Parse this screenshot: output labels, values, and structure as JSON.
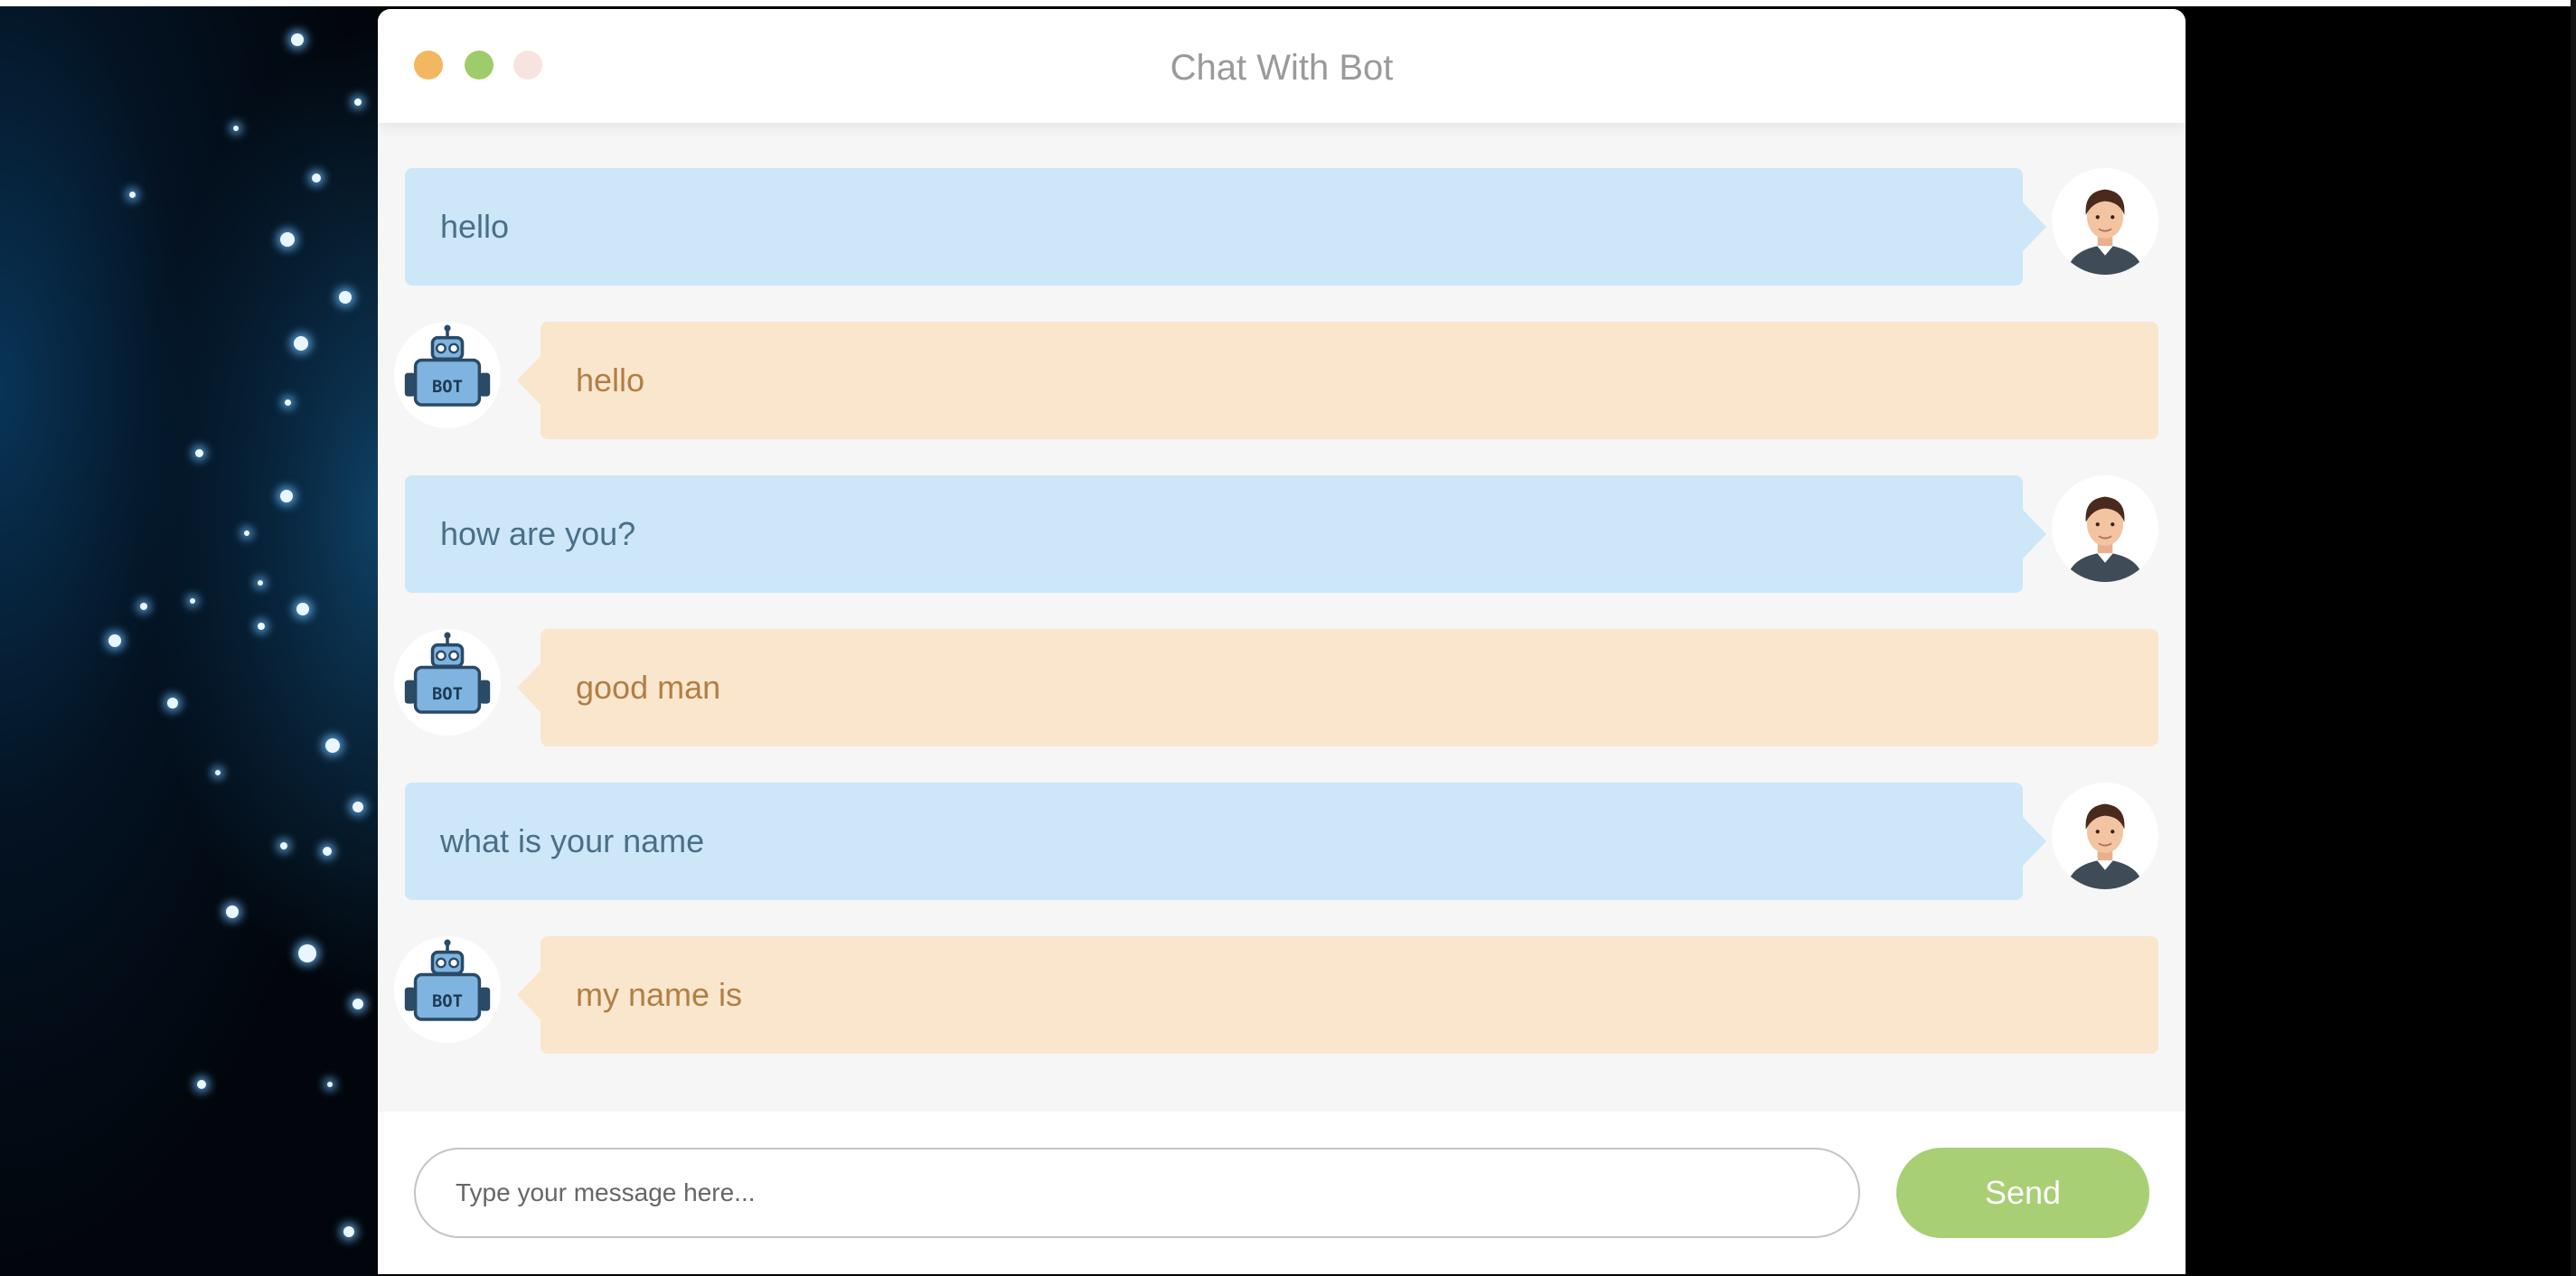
{
  "window": {
    "title": "Chat With Bot",
    "traffic_lights": [
      {
        "name": "close",
        "color": "#f3b661"
      },
      {
        "name": "minimize",
        "color": "#9fcc6a"
      },
      {
        "name": "zoom",
        "color": "#f7e4e0"
      }
    ]
  },
  "messages": [
    {
      "sender": "user",
      "avatar": "user-avatar-icon",
      "text": "hello"
    },
    {
      "sender": "bot",
      "avatar": "robot-bot-icon",
      "text": "hello"
    },
    {
      "sender": "user",
      "avatar": "user-avatar-icon",
      "text": "how are you?"
    },
    {
      "sender": "bot",
      "avatar": "robot-bot-icon",
      "text": "good man"
    },
    {
      "sender": "user",
      "avatar": "user-avatar-icon",
      "text": "what is your name"
    },
    {
      "sender": "bot",
      "avatar": "robot-bot-icon",
      "text": "my name is"
    }
  ],
  "bot_badge": "BOT",
  "input": {
    "value": "",
    "placeholder": "Type your message here..."
  },
  "send_label": "Send",
  "colors": {
    "user_bubble": "#cde7f8",
    "user_text": "#4a6f86",
    "bot_bubble": "#fae6cd",
    "bot_text": "#b07f45",
    "send_button": "#a8cf74",
    "title_text": "#9a9a9a"
  }
}
